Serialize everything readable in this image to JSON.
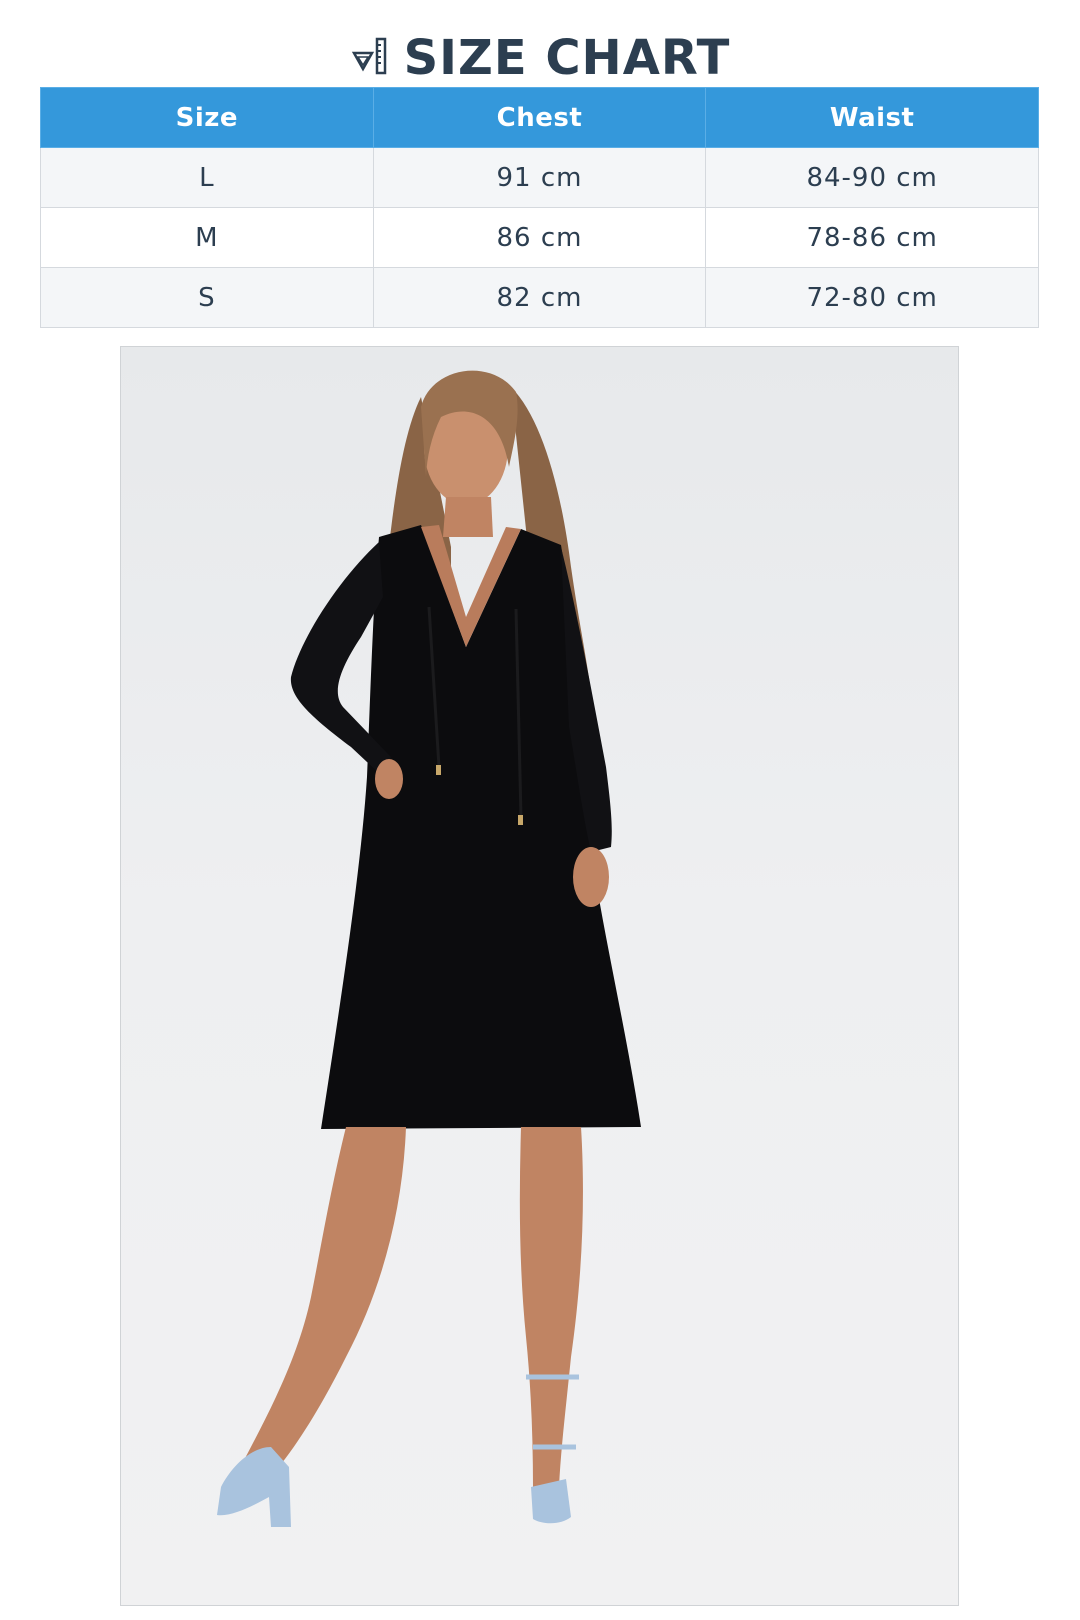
{
  "header": {
    "icon": "ruler-triangle-icon",
    "title": "SIZE CHART"
  },
  "table": {
    "columns": [
      "Size",
      "Chest",
      "Waist"
    ],
    "rows": [
      [
        "L",
        "91 cm",
        "84-90 cm"
      ],
      [
        "M",
        "86 cm",
        "78-86 cm"
      ],
      [
        "S",
        "82 cm",
        "72-80 cm"
      ]
    ]
  },
  "colors": {
    "header_bg": "#3498db",
    "title_text": "#2c3e50",
    "row_alt": "#f4f6f8"
  },
  "photo": {
    "subject": "model-in-black-dress"
  }
}
